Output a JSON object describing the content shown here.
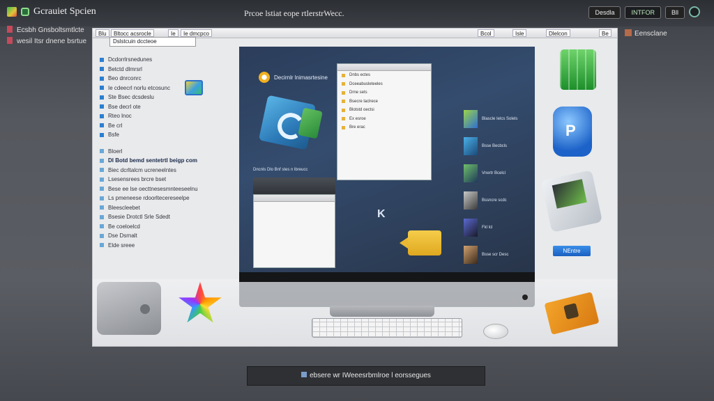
{
  "top_bar": {
    "app_title": "Gcrauiet Spcien",
    "window_title": "Prcoe lstiat eope rtlerstrWecc.",
    "right_buttons": [
      "Desdla",
      "INTFOR",
      "Bll"
    ],
    "sub_left_lines": [
      "Ecsbh Gnsboltsmtlcte",
      "wesil Itsr dnene bsrtue"
    ],
    "sub_right": "Eensclane"
  },
  "toolbar": {
    "items": [
      "Blu",
      "Bltocc acsrocle",
      "Ie",
      "Ie dmcpco"
    ],
    "address": "Dslstcuin dccteoe",
    "right_items": [
      "Bcol",
      "Isle",
      "Dlelcon",
      "Be"
    ]
  },
  "sidebar": {
    "items": [
      {
        "label": "Dcdorrlrsnedunes",
        "bold": false
      },
      {
        "label": "Betctd dlmrsrl",
        "bold": false
      },
      {
        "label": "Beo dnrconrc",
        "bold": false
      },
      {
        "label": "Ie cdeecrl norlu etcosunc",
        "bold": false
      },
      {
        "label": "Ste Bsec dcsdeslu",
        "bold": false
      },
      {
        "label": "Bse decrl ote",
        "bold": false
      },
      {
        "label": "Rteo lnoc",
        "bold": false
      },
      {
        "label": "Be crl",
        "bold": false
      },
      {
        "label": "Bsfe",
        "bold": false
      }
    ],
    "section2": [
      {
        "label": "Bloerl",
        "bold": false
      },
      {
        "label": "Dl Botd bemd sentetrtl beigp com",
        "bold": true
      },
      {
        "label": "Biec dcrltalcm ucreneelntes",
        "bold": false
      },
      {
        "label": "Lsesensrees brcre bset",
        "bold": false
      },
      {
        "label": "Bese ee lse oecttnesesmnteeseelnu",
        "bold": false
      },
      {
        "label": "Ls pmeneese rdoorltecereseelpe",
        "bold": false
      },
      {
        "label": "Bleescleebet",
        "bold": false
      },
      {
        "label": "Bsesie Drotctl Srle Sdedt",
        "bold": false
      },
      {
        "label": "Be coeloelcd",
        "bold": false
      },
      {
        "label": "Dse Dsrnalt",
        "bold": false
      },
      {
        "label": "Elde sreee",
        "bold": false
      }
    ]
  },
  "screen": {
    "title": "Decirnlr lnimasrtesine",
    "mini_window_rows": [
      "Dnbs ectes",
      "Dceeabusleteeles",
      "Drne sets",
      "Bsecre laclrece",
      "Blotstd oectsi",
      "Ex esroe",
      "Bre erac"
    ],
    "lower_caption": "Dncnls Dlo Bnf stes n lbreucc",
    "thumbs": [
      "Blascle Ielcs Solels",
      "Bsse Becbcls",
      "Vnertr Bcelcl",
      "Bssncre scdc",
      "Fkl lcl",
      "Bsse scr Desc"
    ],
    "colors": {
      "accent": "#2c7ab8",
      "video": "#f5cd4a"
    }
  },
  "right_panel": {
    "badge_letter": "P",
    "button_label": "NEntre"
  },
  "caption": "ebsere wr IWeeesrbmlroe l eorssegues"
}
